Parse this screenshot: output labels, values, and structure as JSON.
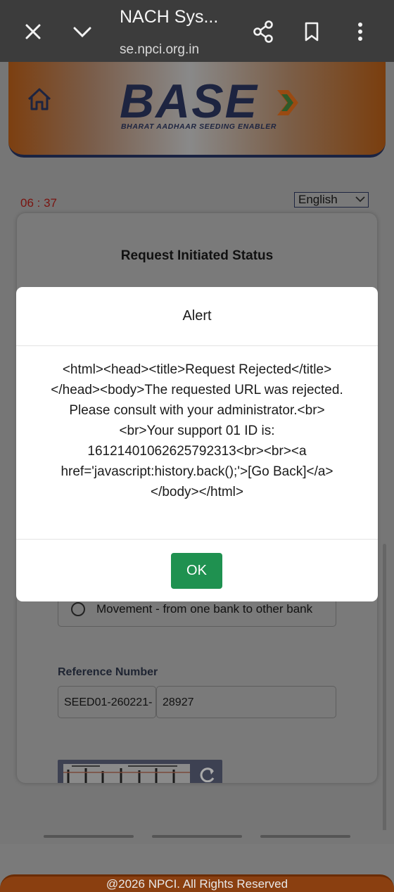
{
  "browser": {
    "title": "NACH Sys...",
    "url": "se.npci.org.in"
  },
  "page": {
    "logo": {
      "text": "BASE",
      "subtitle": "BHARAT AADHAAR SEEDING ENABLER"
    },
    "timer": "06 : 37",
    "language": "English",
    "card_title": "Request Initiated Status",
    "radio_option": "Movement - from one bank to other bank",
    "reference": {
      "label": "Reference Number",
      "part1": "SEED01-260221-",
      "part2": "28927"
    },
    "footer": "@2026 NPCI. All Rights Reserved"
  },
  "modal": {
    "title": "Alert",
    "message_lines": [
      "<html><head><title>Request Rejected</title>",
      "</head><body>The requested URL was rejected.",
      "Please consult with your administrator.<br>",
      "<br>Your support 01 ID is:",
      "16121401062625792313<br><br><a",
      "href='javascript:history.back();'>[Go Back]</a>",
      "</body></html>"
    ],
    "ok_label": "OK"
  },
  "colors": {
    "ok_button": "#1f9150",
    "browser_bar": "#3c3c3c",
    "timer": "#b0231b"
  }
}
